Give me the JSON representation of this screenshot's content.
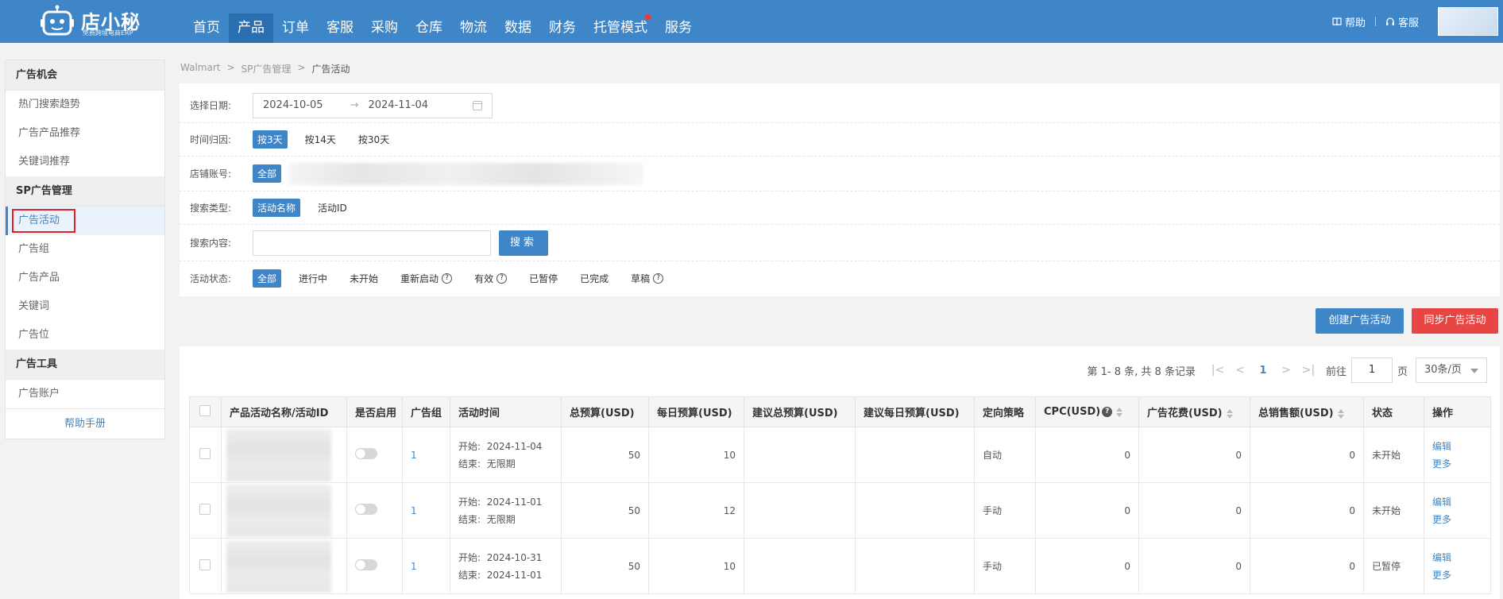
{
  "header": {
    "logo_text": "店小秘",
    "logo_sub": "免费跨境电商ERP",
    "nav": [
      {
        "label": "首页"
      },
      {
        "label": "产品",
        "active": true
      },
      {
        "label": "订单"
      },
      {
        "label": "客服"
      },
      {
        "label": "采购"
      },
      {
        "label": "仓库"
      },
      {
        "label": "物流"
      },
      {
        "label": "数据"
      },
      {
        "label": "财务"
      },
      {
        "label": "托管模式",
        "dot": true
      },
      {
        "label": "服务"
      }
    ],
    "help": "帮助",
    "service": "客服",
    "colors": {
      "bar": "#3f86c8",
      "dot": "#ff3030"
    }
  },
  "sidebar": {
    "group1": "广告机会",
    "g1_items": [
      "热门搜索趋势",
      "广告产品推荐",
      "关键词推荐"
    ],
    "group2": "SP广告管理",
    "g2_items": [
      "广告活动",
      "广告组",
      "广告产品",
      "关键词",
      "广告位"
    ],
    "group3": "广告工具",
    "g3_items": [
      "广告账户"
    ],
    "help": "帮助手册"
  },
  "breadcrumb": [
    "Walmart",
    ">",
    "SP广告管理",
    ">",
    "广告活动"
  ],
  "filters": {
    "date_label": "选择日期:",
    "date_start": "2024-10-05",
    "date_arrow": "→",
    "date_end": "2024-11-04",
    "attr_label": "时间归因:",
    "attr_opts": [
      "按3天",
      "按14天",
      "按30天"
    ],
    "shop_label": "店铺账号:",
    "shop_all": "全部",
    "type_label": "搜索类型:",
    "type_opts": [
      "活动名称",
      "活动ID"
    ],
    "content_label": "搜索内容:",
    "search_btn": "搜索",
    "status_label": "活动状态:",
    "status_opts": [
      "全部",
      "进行中",
      "未开始",
      "重新启动",
      "有效",
      "已暂停",
      "已完成",
      "草稿"
    ]
  },
  "actions": {
    "create": "创建广告活动",
    "sync": "同步广告活动"
  },
  "pager": {
    "summary": "第 1- 8 条, 共 8 条记录",
    "current": "1",
    "goto_label": "前往",
    "goto_value": "1",
    "page_unit": "页",
    "page_size": "30条/页"
  },
  "table": {
    "headers": [
      "产品活动名称/活动ID",
      "是否启用",
      "广告组",
      "活动时间",
      "总预算(USD)",
      "每日预算(USD)",
      "建议总预算(USD)",
      "建议每日预算(USD)",
      "定向策略",
      "CPC(USD)",
      "广告花费(USD)",
      "总销售额(USD)",
      "状态",
      "操作"
    ],
    "cpc_help": "?",
    "rows": [
      {
        "group": "1",
        "start_label": "开始:",
        "start": "2024-11-04",
        "end_label": "结束:",
        "end": "无限期",
        "total": "50",
        "daily": "10",
        "strategy": "自动",
        "cpc": "0",
        "spend": "0",
        "sales": "0",
        "status": "未开始",
        "edit": "编辑",
        "more": "更多"
      },
      {
        "group": "1",
        "start_label": "开始:",
        "start": "2024-11-01",
        "end_label": "结束:",
        "end": "无限期",
        "total": "50",
        "daily": "12",
        "strategy": "手动",
        "cpc": "0",
        "spend": "0",
        "sales": "0",
        "status": "未开始",
        "edit": "编辑",
        "more": "更多"
      },
      {
        "group": "1",
        "start_label": "开始:",
        "start": "2024-10-31",
        "end_label": "结束:",
        "end": "2024-11-01",
        "total": "50",
        "daily": "10",
        "strategy": "手动",
        "cpc": "0",
        "spend": "0",
        "sales": "0",
        "status": "已暂停",
        "edit": "编辑",
        "more": "更多"
      }
    ]
  }
}
